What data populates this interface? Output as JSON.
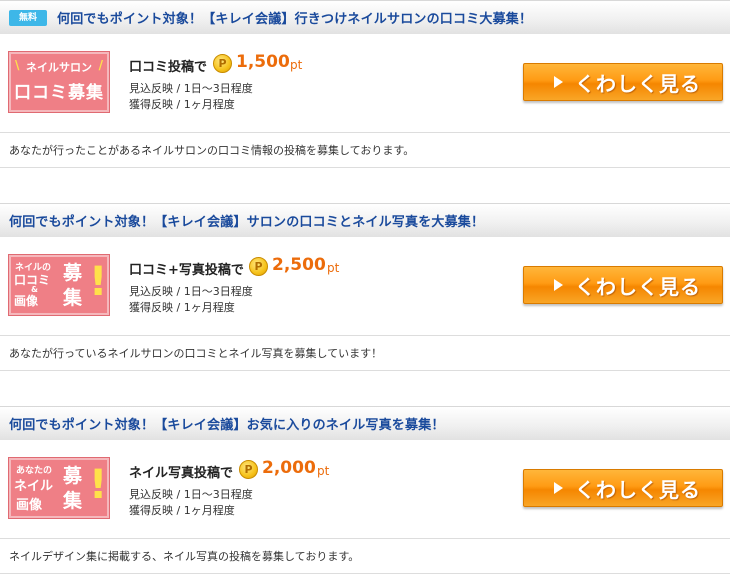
{
  "offers": [
    {
      "badge": "無料",
      "title": "何回でもポイント対象！【キレイ会議】行きつけネイルサロンの口コミ大募集！",
      "banner": {
        "line1": "ネイルサロン",
        "line2": "口コミ募集"
      },
      "action": "口コミ投稿で",
      "coin": "P",
      "points": "1,500",
      "unit": "pt",
      "reflect": "見込反映 / 1日～3日程度",
      "acquire": "獲得反映 / 1ヶ月程度",
      "button": "くわしく見る",
      "description": "あなたが行ったことがあるネイルサロンの口コミ情報の投稿を募集しております。"
    },
    {
      "title": "何回でもポイント対象！【キレイ会議】サロンの口コミとネイル写真を大募集！",
      "banner": {
        "line1": "ネイルの",
        "line2": "口コミ",
        "line3": "&",
        "line4": "画像",
        "big1": "募",
        "big2": "集",
        "mark": "!"
      },
      "action": "口コミ+写真投稿で",
      "coin": "P",
      "points": "2,500",
      "unit": "pt",
      "reflect": "見込反映 / 1日～3日程度",
      "acquire": "獲得反映 / 1ヶ月程度",
      "button": "くわしく見る",
      "description": "あなたが行っているネイルサロンの口コミとネイル写真を募集しています！"
    },
    {
      "title": "何回でもポイント対象！【キレイ会議】お気に入りのネイル写真を募集！",
      "banner": {
        "line1": "あなたの",
        "line2": "ネイル",
        "line4": "画像",
        "big1": "募",
        "big2": "集",
        "mark": "!"
      },
      "action": "ネイル写真投稿で",
      "coin": "P",
      "points": "2,000",
      "unit": "pt",
      "reflect": "見込反映 / 1日～3日程度",
      "acquire": "獲得反映 / 1ヶ月程度",
      "button": "くわしく見る",
      "description": "ネイルデザイン集に掲載する、ネイル写真の投稿を募集しております。"
    }
  ]
}
